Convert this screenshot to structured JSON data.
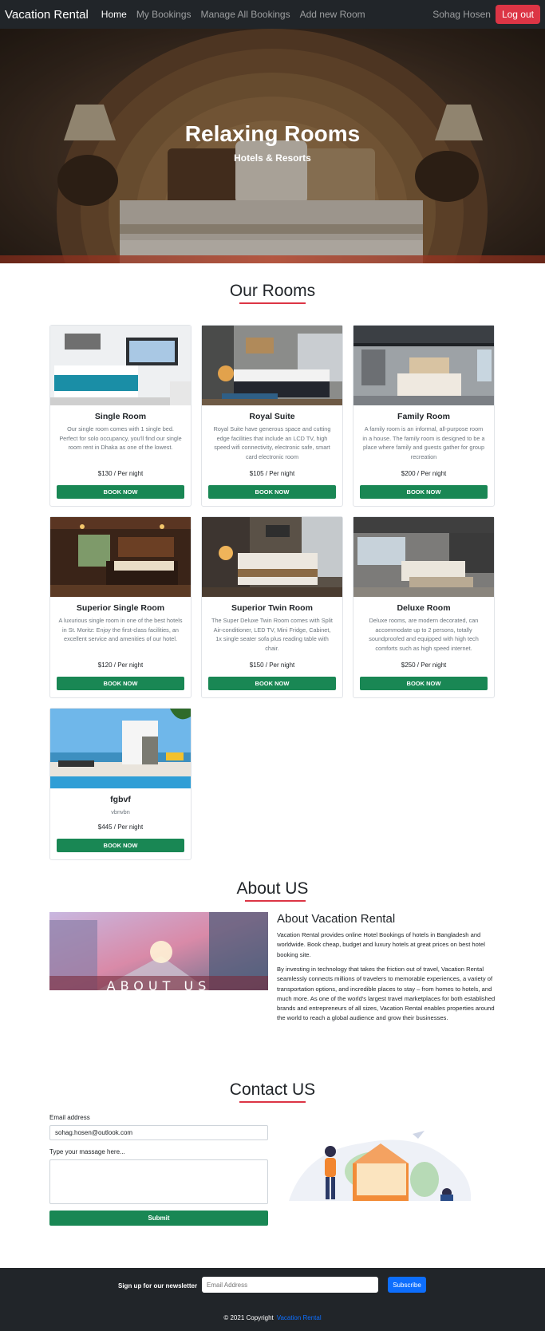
{
  "navbar": {
    "brand": "Vacation Rental",
    "links": [
      "Home",
      "My Bookings",
      "Manage All Bookings",
      "Add new Room"
    ],
    "user": "Sohag Hosen",
    "logout": "Log out"
  },
  "hero": {
    "title": "Relaxing Rooms",
    "subtitle": "Hotels & Resorts"
  },
  "rooms_section": {
    "title": "Our Rooms",
    "rooms": [
      {
        "name": "Single Room",
        "description": "Our single room comes with 1 single bed. Perfect for solo occupancy, you'll find our single room rent in Dhaka as one of the lowest.",
        "price": "$130 / Per night",
        "button": "BOOK NOW"
      },
      {
        "name": "Royal Suite",
        "description": "Royal Suite have generous space and cutting edge facilities that include an LCD TV, high speed wifi connectivity, electronic safe, smart card electronic room",
        "price": "$105 / Per night",
        "button": "BOOK NOW"
      },
      {
        "name": "Family Room",
        "description": "A family room is an informal, all-purpose room in a house. The family room is designed to be a place where family and guests gather for group recreation",
        "price": "$200 / Per night",
        "button": "BOOK NOW"
      },
      {
        "name": "Superior Single Room",
        "description": "A luxurious single room in one of the best hotels in St. Moritz: Enjoy the first-class facilities, an excellent service and amenities of our hotel.",
        "price": "$120 / Per night",
        "button": "BOOK NOW"
      },
      {
        "name": "Superior Twin Room",
        "description": "The Super Deluxe Twin Room comes with Split Air-conditioner, LED TV, Mini Fridge, Cabinet, 1x single seater sofa plus reading table with chair.",
        "price": "$150 / Per night",
        "button": "BOOK NOW"
      },
      {
        "name": "Deluxe Room",
        "description": "Deluxe rooms, are modern decorated, can accommodate up to 2 persons, totally soundproofed and equipped with high tech comforts such as high speed internet.",
        "price": "$250 / Per night",
        "button": "BOOK NOW"
      },
      {
        "name": "fgbvf",
        "description": "vbnvbn",
        "price": "$445 / Per night",
        "button": "BOOK NOW"
      }
    ]
  },
  "about": {
    "title": "About US",
    "image_text": "ABOUT US",
    "heading": "About Vacation Rental",
    "paragraph1": "Vacation Rental provides online Hotel Bookings of hotels in Bangladesh and worldwide. Book cheap, budget and luxury hotels at great prices on best hotel booking site.",
    "paragraph2": "By investing in technology that takes the friction out of travel, Vacation Rental seamlessly connects millions of travelers to memorable experiences, a variety of transportation options, and incredible places to stay – from homes to hotels, and much more. As one of the world's largest travel marketplaces for both established brands and entrepreneurs of all sizes, Vacation Rental enables properties around the world to reach a global audience and grow their businesses."
  },
  "contact": {
    "title": "Contact US",
    "email_label": "Email address",
    "email_value": "sohag.hosen@outlook.com",
    "message_label": "Type your massage here...",
    "submit": "Submit"
  },
  "footer": {
    "newsletter_label": "Sign up for our newsletter",
    "email_placeholder": "Email Address",
    "subscribe": "Subscribe",
    "copyright": "© 2021 Copyright",
    "copyright_link": "Vacation Rental"
  },
  "colors": {
    "navbar": "#212529",
    "accent_red": "#dc3545",
    "book_green": "#198754",
    "subscribe_blue": "#0d6efd"
  }
}
